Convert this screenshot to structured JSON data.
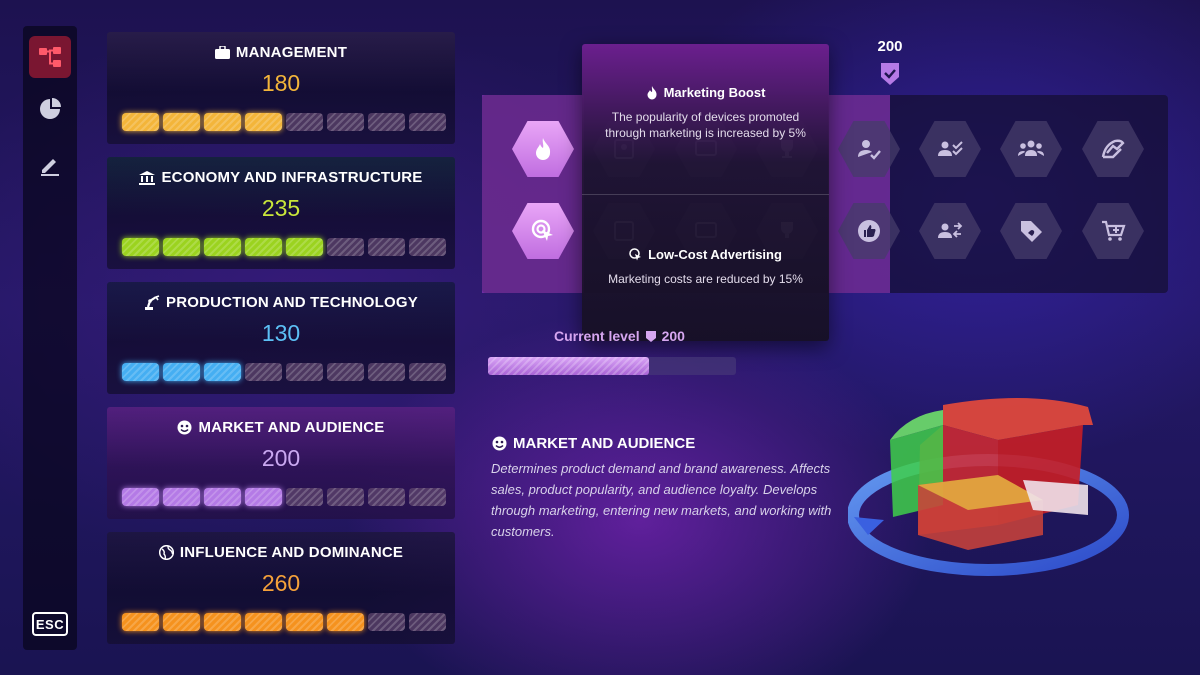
{
  "sidebar": {
    "items": [
      {
        "icon": "tree-icon",
        "active": true
      },
      {
        "icon": "pie-chart-icon",
        "active": false
      },
      {
        "icon": "pencil-icon",
        "active": false
      }
    ],
    "esc_label": "ESC"
  },
  "stats": [
    {
      "icon": "briefcase-icon",
      "title": "MANAGEMENT",
      "value": "180",
      "color": "#f3b53a",
      "filled": 4,
      "total": 8
    },
    {
      "icon": "bank-icon",
      "title": "ECONOMY AND INFRASTRUCTURE",
      "value": "235",
      "color": "#9bd31f",
      "filled": 5,
      "total": 8
    },
    {
      "icon": "robot-arm-icon",
      "title": "PRODUCTION AND TECHNOLOGY",
      "value": "130",
      "color": "#45aef2",
      "filled": 3,
      "total": 8
    },
    {
      "icon": "face-icon",
      "title": "MARKET AND AUDIENCE",
      "value": "200",
      "color": "#b47ae6",
      "filled": 4,
      "total": 8
    },
    {
      "icon": "globe-icon",
      "title": "INFLUENCE AND DOMINANCE",
      "value": "260",
      "color": "#f5921e",
      "filled": 6,
      "total": 8
    }
  ],
  "skills": {
    "badge_value": "200",
    "tooltip": {
      "first_title": "Marketing Boost",
      "first_desc": "The popularity of devices promoted through marketing is increased by 5%",
      "second_title": "Low-Cost Advertising",
      "second_desc": "Marketing costs are reduced by 15%"
    }
  },
  "level": {
    "label": "Current level",
    "value": "200",
    "progress": 0.65
  },
  "description": {
    "title": "MARKET AND AUDIENCE",
    "text": "Determines product demand and brand awareness. Affects sales, product popularity, and audience loyalty. Develops through marketing, entering new markets, and working with customers."
  }
}
